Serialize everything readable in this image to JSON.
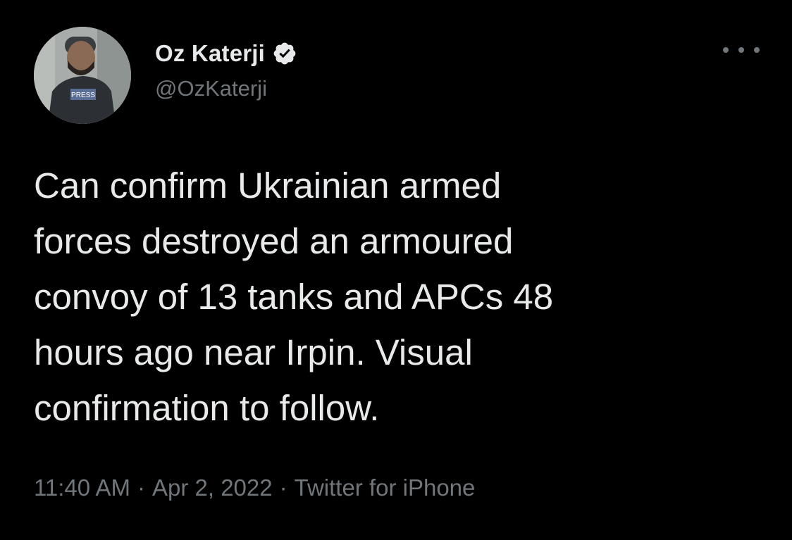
{
  "author": {
    "display_name": "Oz Katerji",
    "handle": "@OzKaterji",
    "verified_icon": "verified-badge-icon",
    "avatar_vest_label": "PRESS"
  },
  "menu": {
    "more_icon": "more-horizontal-icon"
  },
  "tweet": {
    "text": "Can confirm Ukrainian armed\nforces destroyed an armoured\nconvoy of 13 tanks and APCs 48\nhours ago near Irpin. Visual\nconfirmation to follow."
  },
  "meta": {
    "time": "11:40 AM",
    "separator": "·",
    "date": "Apr 2, 2022",
    "source": "Twitter for iPhone"
  },
  "colors": {
    "background": "#000000",
    "primary_text": "#e7e9ea",
    "secondary_text": "#71767b"
  }
}
